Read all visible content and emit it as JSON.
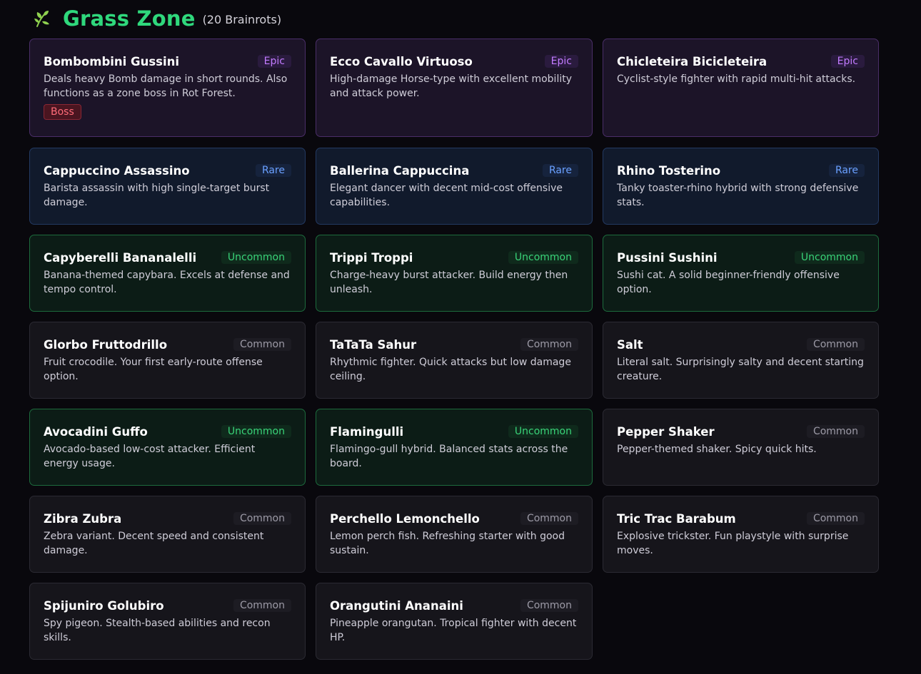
{
  "header": {
    "icon": "leaf-icon",
    "title": "Grass Zone",
    "count": "(20 Brainrots)"
  },
  "colors": {
    "title": "#2fd87c",
    "epic": "#c27bff",
    "rare": "#6aa0ff",
    "uncommon": "#39d378",
    "common": "#9c9aa6",
    "boss": "#ff6b78"
  },
  "cards": [
    {
      "name": "Bombombini Gussini",
      "rarity": "Epic",
      "desc": "Deals heavy Bomb damage in short rounds. Also functions as a zone boss in Rot Forest.",
      "badge": "Boss"
    },
    {
      "name": "Ecco Cavallo Virtuoso",
      "rarity": "Epic",
      "desc": "High-damage Horse-type with excellent mobility and attack power."
    },
    {
      "name": "Chicleteira Bicicleteira",
      "rarity": "Epic",
      "desc": "Cyclist-style fighter with rapid multi-hit attacks."
    },
    {
      "name": "Cappuccino Assassino",
      "rarity": "Rare",
      "desc": "Barista assassin with high single-target burst damage."
    },
    {
      "name": "Ballerina Cappuccina",
      "rarity": "Rare",
      "desc": "Elegant dancer with decent mid-cost offensive capabilities."
    },
    {
      "name": "Rhino Tosterino",
      "rarity": "Rare",
      "desc": "Tanky toaster-rhino hybrid with strong defensive stats."
    },
    {
      "name": "Capyberelli Bananalelli",
      "rarity": "Uncommon",
      "desc": "Banana-themed capybara. Excels at defense and tempo control."
    },
    {
      "name": "Trippi Troppi",
      "rarity": "Uncommon",
      "desc": "Charge-heavy burst attacker. Build energy then unleash."
    },
    {
      "name": "Pussini Sushini",
      "rarity": "Uncommon",
      "desc": "Sushi cat. A solid beginner-friendly offensive option."
    },
    {
      "name": "Glorbo Fruttodrillo",
      "rarity": "Common",
      "desc": "Fruit crocodile. Your first early-route offense option."
    },
    {
      "name": "TaTaTa Sahur",
      "rarity": "Common",
      "desc": "Rhythmic fighter. Quick attacks but low damage ceiling."
    },
    {
      "name": "Salt",
      "rarity": "Common",
      "desc": "Literal salt. Surprisingly salty and decent starting creature."
    },
    {
      "name": "Avocadini Guffo",
      "rarity": "Uncommon",
      "desc": "Avocado-based low-cost attacker. Efficient energy usage."
    },
    {
      "name": "Flamingulli",
      "rarity": "Uncommon",
      "desc": "Flamingo-gull hybrid. Balanced stats across the board."
    },
    {
      "name": "Pepper Shaker",
      "rarity": "Common",
      "desc": "Pepper-themed shaker. Spicy quick hits."
    },
    {
      "name": "Zibra Zubra",
      "rarity": "Common",
      "desc": "Zebra variant. Decent speed and consistent damage."
    },
    {
      "name": "Perchello Lemonchello",
      "rarity": "Common",
      "desc": "Lemon perch fish. Refreshing starter with good sustain."
    },
    {
      "name": "Tric Trac Barabum",
      "rarity": "Common",
      "desc": "Explosive trickster. Fun playstyle with surprise moves."
    },
    {
      "name": "Spijuniro Golubiro",
      "rarity": "Common",
      "desc": "Spy pigeon. Stealth-based abilities and recon skills."
    },
    {
      "name": "Orangutini Ananaini",
      "rarity": "Common",
      "desc": "Pineapple orangutan. Tropical fighter with decent HP."
    }
  ]
}
